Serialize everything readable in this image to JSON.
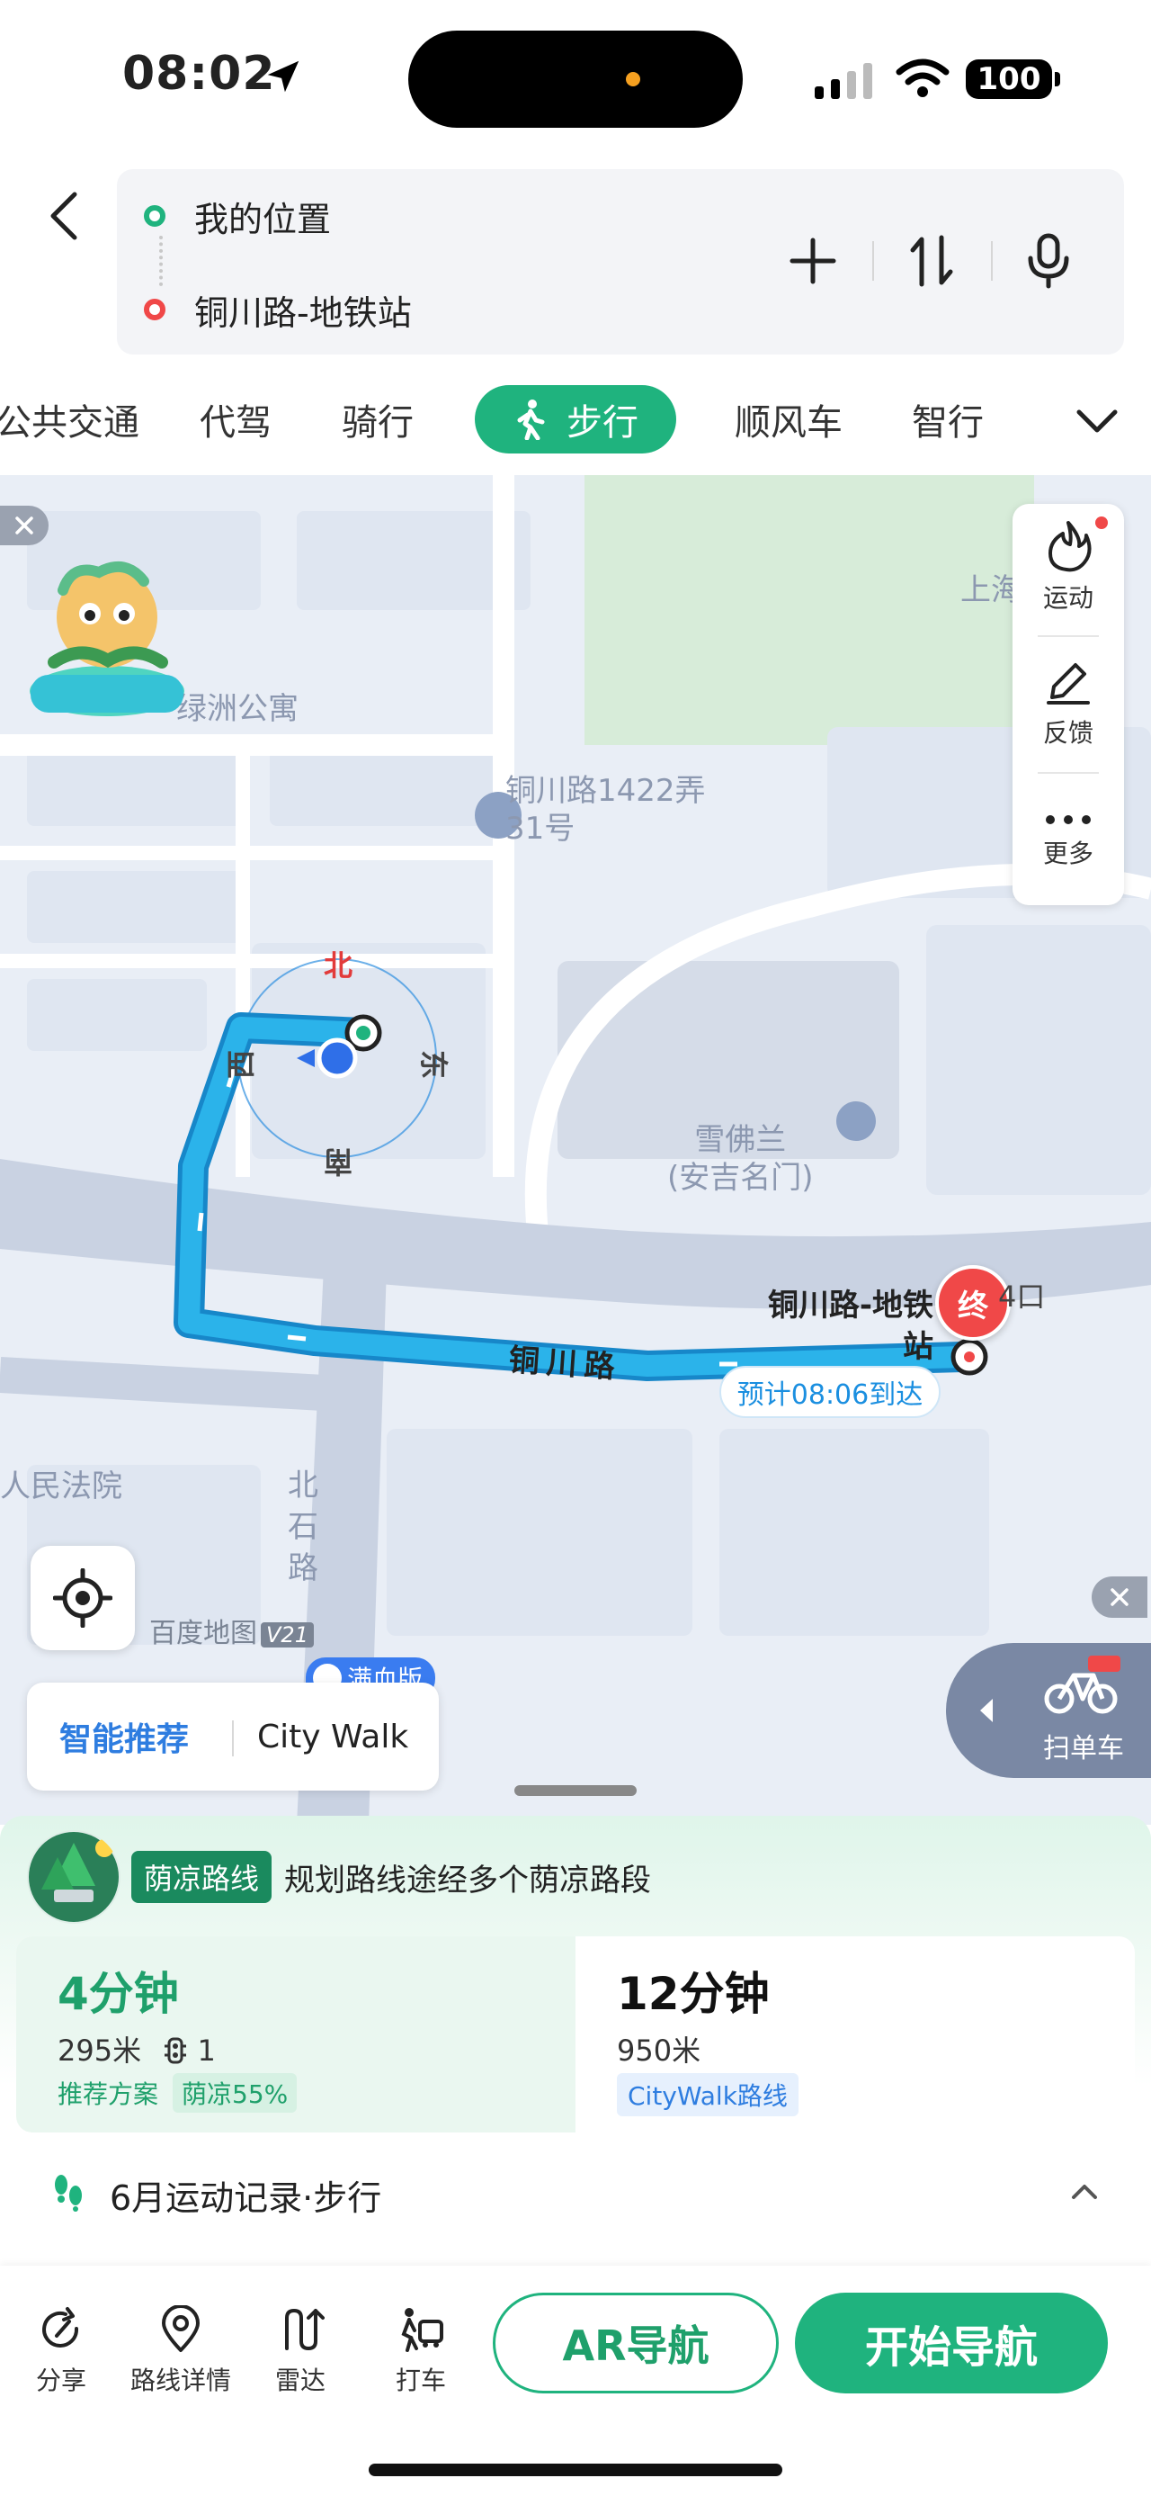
{
  "status_bar": {
    "time": "08:02",
    "battery": "100"
  },
  "route": {
    "start": "我的位置",
    "end": "铜川路-地铁站",
    "icons": [
      "back-arrow-icon",
      "plus-icon",
      "swap-icon",
      "microphone-icon"
    ]
  },
  "modes": {
    "items": [
      {
        "label": "公共交通"
      },
      {
        "label": "代驾"
      },
      {
        "label": "骑行"
      },
      {
        "label": "步行",
        "active": true
      },
      {
        "label": "顺风车"
      },
      {
        "label": "智行"
      }
    ]
  },
  "map": {
    "labels": {
      "apartment": "绿洲公寓",
      "poi": "铜川路1422弄",
      "poi_2": "31号",
      "store": "雪佛兰",
      "store_2": "(安吉名门)",
      "court": "人民法院",
      "top_right": "上海",
      "road_name": "铜川路",
      "side_road": "北石路"
    },
    "compass": {
      "north": "北",
      "south": "南",
      "east": "东",
      "west": "西"
    },
    "side_tools": [
      {
        "label": "运动",
        "icon": "flame-icon"
      },
      {
        "label": "反馈",
        "icon": "pencil-icon"
      },
      {
        "label": "更多",
        "icon": "more-icon"
      }
    ],
    "destination": "铜川路-地铁站",
    "end_marker": "终",
    "exit_label": "4口",
    "eta": "预计08:06到达",
    "brand": "百度地图",
    "brand_version": "V21",
    "full_badge": "满血版",
    "recommend": {
      "smart": "智能推荐",
      "citywalk": "City Walk"
    },
    "scan_bike": "扫单车",
    "colors": {
      "route": "#2bb3ea",
      "route_border": "#1787c9",
      "road": "#c9d2e2",
      "green_area": "#d7ecd9"
    }
  },
  "sheet": {
    "shade_tag": "荫凉路线",
    "shade_desc": "规划路线途经多个荫凉路段",
    "plans": [
      {
        "time": "4分钟",
        "distance": "295米",
        "lights": "1",
        "tag1": "推荐方案",
        "tag2": "荫凉55%"
      },
      {
        "time": "12分钟",
        "distance": "950米",
        "tag1": "CityWalk路线"
      }
    ],
    "record": "6月运动记录·步行"
  },
  "bottom_bar": {
    "items": [
      {
        "label": "分享",
        "icon": "share-icon"
      },
      {
        "label": "路线详情",
        "icon": "route-detail-icon"
      },
      {
        "label": "雷达",
        "icon": "radar-icon"
      },
      {
        "label": "打车",
        "icon": "taxi-icon"
      }
    ],
    "ar_nav": "AR导航",
    "start_nav": "开始导航"
  },
  "accent_color": "#1fb37e"
}
